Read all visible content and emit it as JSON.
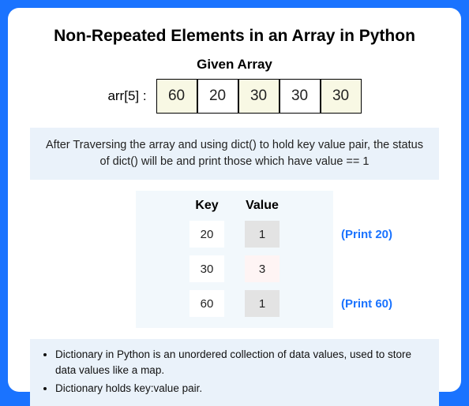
{
  "title": "Non-Repeated Elements in an Array in Python",
  "given_array_label": "Given Array",
  "arr_label": "arr[5] :",
  "arr_values": [
    "60",
    "20",
    "30",
    "30",
    "30"
  ],
  "explain": "After Traversing the array and using dict() to hold key value pair, the status of dict() will be and print those which have value == 1",
  "dict_header": {
    "key": "Key",
    "value": "Value"
  },
  "dict_rows": [
    {
      "key": "20",
      "value": "1",
      "highlight": true,
      "print": "(Print 20)"
    },
    {
      "key": "30",
      "value": "3",
      "highlight": false,
      "print": ""
    },
    {
      "key": "60",
      "value": "1",
      "highlight": true,
      "print": "(Print 60)"
    }
  ],
  "notes": [
    "Dictionary in Python is an unordered collection of data values, used to store data values like a map.",
    "Dictionary holds key:value pair."
  ]
}
